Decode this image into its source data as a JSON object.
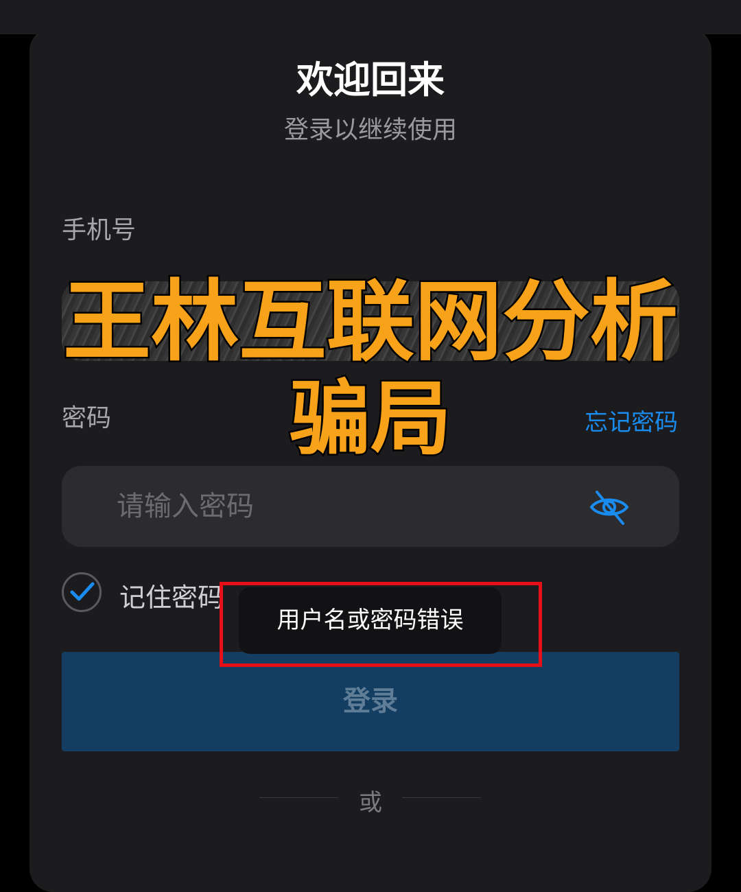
{
  "header": {
    "title": "欢迎回来",
    "subtitle": "登录以继续使用"
  },
  "phone": {
    "label": "手机号",
    "clear_icon": "close-icon"
  },
  "password": {
    "label": "密码",
    "forgot_link": "忘记密码",
    "placeholder": "请输入密码",
    "visibility_icon": "eye-off-icon"
  },
  "remember": {
    "label": "记住密码",
    "checked": true
  },
  "login_button": "登录",
  "divider_text": "或",
  "toast": "用户名或密码错误",
  "watermark": {
    "line1": "王林互联网分析",
    "line2": "骗局"
  },
  "colors": {
    "accent": "#1a8cf0",
    "background": "#000000",
    "card": "#1c1c1e",
    "input": "#2c2c2e",
    "button": "#133e62",
    "watermark": "#f8a21a",
    "highlight_box": "#e81018"
  }
}
